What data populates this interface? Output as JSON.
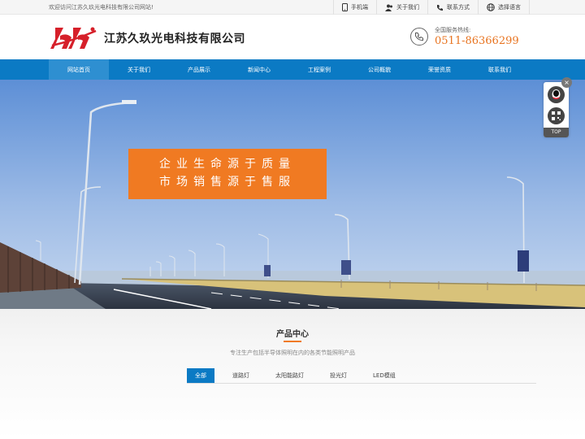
{
  "topbar": {
    "welcome": "欢迎访问江苏久玖光电科技有限公司网站!",
    "links": [
      {
        "label": "手机端",
        "icon": "mobile-icon"
      },
      {
        "label": "关于我们",
        "icon": "users-icon"
      },
      {
        "label": "联系方式",
        "icon": "phone-icon"
      },
      {
        "label": "选择语言",
        "icon": "globe-icon"
      }
    ]
  },
  "header": {
    "company_name": "江苏久玖光电科技有限公司",
    "hotline_label": "全国服务热线:",
    "hotline_number": "0511-86366299"
  },
  "nav": {
    "items": [
      "网站首页",
      "关于我们",
      "产品展示",
      "新闻中心",
      "工程案例",
      "公司概貌",
      "荣誉资质",
      "联系我们"
    ],
    "active_index": 0
  },
  "banner": {
    "slogan_line1": "企业生命源于质量",
    "slogan_line2": "市场销售源于售服"
  },
  "sidetool": {
    "close": "×",
    "top_label": "TOP"
  },
  "products": {
    "title": "产品中心",
    "description": "专注生产包括半导体照明在内的各类节能照明产品",
    "tabs": [
      "全部",
      "道路灯",
      "太阳能路灯",
      "投光灯",
      "LED模组"
    ],
    "active_tab": 0
  },
  "colors": {
    "nav_blue": "#0b7ac4",
    "accent_orange": "#f07a22",
    "logo_red": "#d6202a"
  }
}
